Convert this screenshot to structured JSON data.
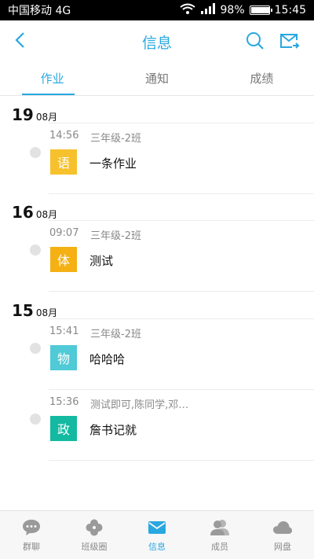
{
  "status_bar": {
    "carrier": "中国移动 4G",
    "network": "4G",
    "battery": "98%",
    "battery_level": 0.98,
    "time": "15:45"
  },
  "header": {
    "title": "信息",
    "back_icon": "chevron-left-icon",
    "search_icon": "search-icon",
    "mail_icon": "mail-forward-icon"
  },
  "tabs": [
    {
      "label": "作业",
      "active": true
    },
    {
      "label": "通知",
      "active": false
    },
    {
      "label": "成绩",
      "active": false
    }
  ],
  "groups": [
    {
      "day": "19",
      "month": "08月",
      "items": [
        {
          "time": "14:56",
          "class": "三年级-2班",
          "badge": "语",
          "badge_color": "#f6c12c",
          "title": "一条作业"
        }
      ]
    },
    {
      "day": "16",
      "month": "08月",
      "items": [
        {
          "time": "09:07",
          "class": "三年级-2班",
          "badge": "体",
          "badge_color": "#f5b014",
          "title": "测试"
        }
      ]
    },
    {
      "day": "15",
      "month": "08月",
      "items": [
        {
          "time": "15:41",
          "class": "三年级-2班",
          "badge": "物",
          "badge_color": "#4fcad6",
          "title": "哈哈哈"
        },
        {
          "time": "15:36",
          "class": "测试即可,陈同学,邓…",
          "badge": "政",
          "badge_color": "#13b9a1",
          "title": "詹书记就"
        }
      ]
    }
  ],
  "bottom_nav": [
    {
      "label": "群聊",
      "icon": "chat-bubble-icon",
      "active": false
    },
    {
      "label": "班级圈",
      "icon": "clover-icon",
      "active": false
    },
    {
      "label": "信息",
      "icon": "envelope-icon",
      "active": true
    },
    {
      "label": "成员",
      "icon": "members-icon",
      "active": false
    },
    {
      "label": "网盘",
      "icon": "cloud-icon",
      "active": false
    }
  ],
  "colors": {
    "accent": "#29a8e0",
    "inactive": "#8a8a8a",
    "status_bar": "#000000"
  }
}
